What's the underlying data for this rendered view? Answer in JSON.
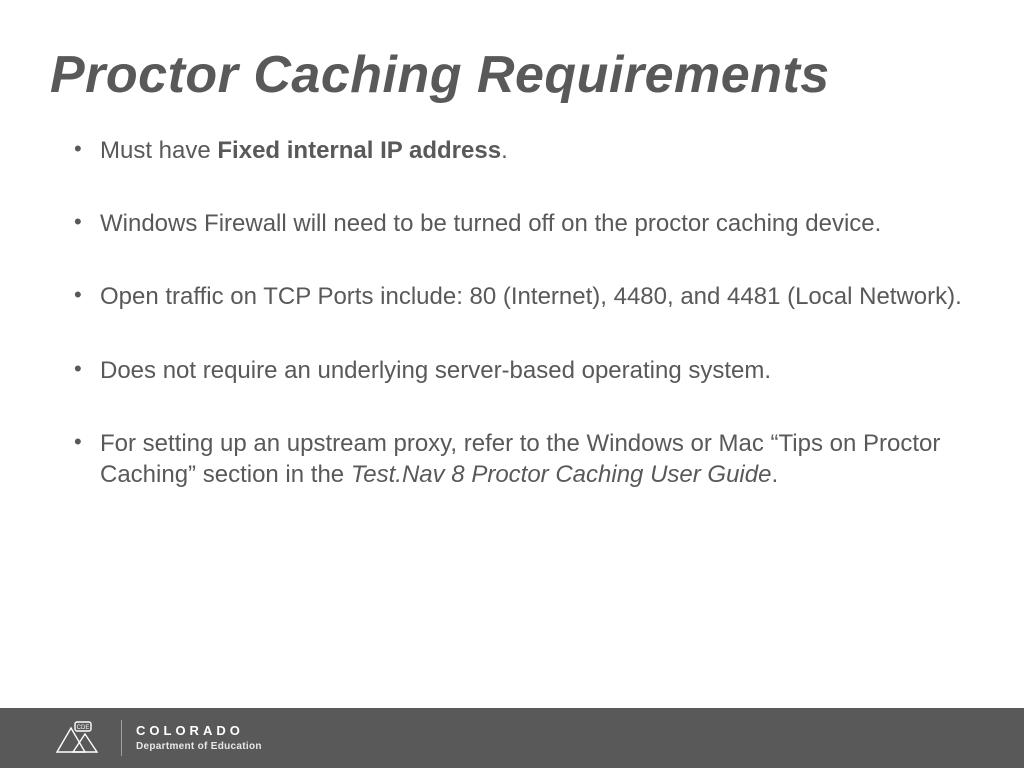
{
  "title": "Proctor Caching Requirements",
  "bullets": [
    {
      "pre": "Must have ",
      "bold": "Fixed internal IP address",
      "post": "."
    },
    {
      "text": "Windows Firewall will need to be turned off on the proctor caching device."
    },
    {
      "text": "Open traffic on TCP Ports include: 80 (Internet), 4480,  and 4481 (Local Network)."
    },
    {
      "text": "Does not require an underlying server-based operating system."
    },
    {
      "pre": "For setting up an upstream proxy, refer to the Windows or Mac “Tips on Proctor Caching” section in the ",
      "italic": "Test.Nav 8 Proctor Caching User Guide",
      "post": "."
    }
  ],
  "footer": {
    "badge": "CDE",
    "line1": "COLORADO",
    "line2": "Department of Education"
  }
}
